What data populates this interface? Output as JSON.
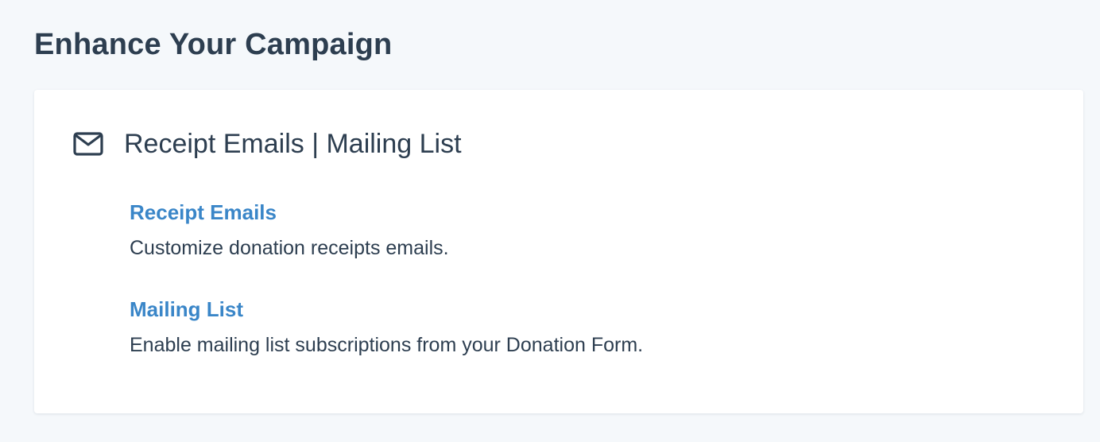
{
  "page": {
    "title": "Enhance Your Campaign"
  },
  "card": {
    "icon": "mail-icon",
    "title": "Receipt Emails | Mailing List",
    "items": [
      {
        "label": "Receipt Emails",
        "description": "Customize donation receipts emails."
      },
      {
        "label": "Mailing List",
        "description": "Enable mailing list subscriptions from your Donation Form."
      }
    ]
  },
  "colors": {
    "background": "#f5f8fb",
    "text": "#2d3e50",
    "link": "#3a86c8",
    "card": "#ffffff"
  }
}
